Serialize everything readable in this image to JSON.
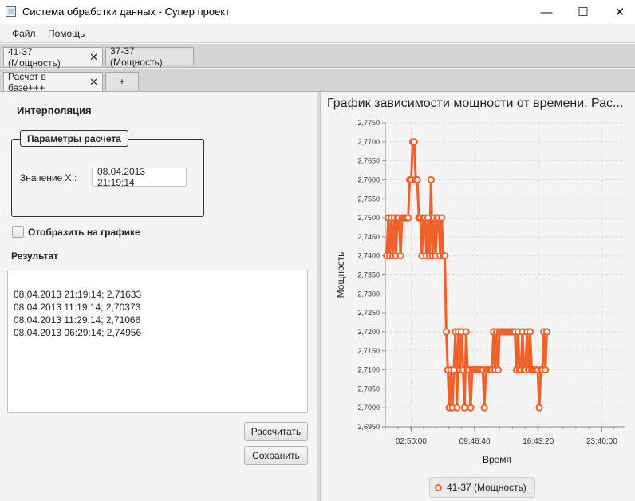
{
  "window": {
    "title": "Система обработки данных - Супер проект",
    "minimize": "—",
    "maximize": "☐",
    "close": "✕"
  },
  "menu": [
    "Файл",
    "Помощь"
  ],
  "tabs_row1": [
    {
      "label": "41-37 (Мощность)",
      "closable": true,
      "selected": true
    },
    {
      "label": "37-37 (Мощность)",
      "closable": false,
      "selected": false
    }
  ],
  "tabs_row2": [
    {
      "label": "Расчет в базе+++",
      "closable": true,
      "selected": true
    },
    {
      "label": "+",
      "closable": false,
      "selected": false
    }
  ],
  "form": {
    "heading": "Интерполяция",
    "group_title": "Параметры расчета",
    "x_label": "Значение X :",
    "x_value": "08.04.2013 21:19:14",
    "show_on_chart_label": "Отобразить на графике",
    "show_on_chart_checked": false,
    "result_label": "Результат",
    "result_lines": [
      "08.04.2013 21:19:14; 2,71633",
      "08.04.2013 11:19:14; 2,70373",
      "08.04.2013 11:29:14; 2,71066",
      "08.04.2013 06:29:14; 2,74956"
    ],
    "calc_button": "Рассчитать",
    "save_button": "Сохранить"
  },
  "accent": "#f0612a",
  "chart_data": {
    "type": "line",
    "title": "График зависимости мощности от времени. Рас...",
    "xlabel": "Время",
    "ylabel": "Мощность",
    "ylim": [
      2.695,
      2.775
    ],
    "yticks": [
      "2,6950",
      "2,7000",
      "2,7050",
      "2,7100",
      "2,7150",
      "2,7200",
      "2,7250",
      "2,7300",
      "2,7350",
      "2,7400",
      "2,7450",
      "2,7500",
      "2,7550",
      "2,7600",
      "2,7650",
      "2,7700",
      "2,7750"
    ],
    "xticks": [
      "02:50:00",
      "09:46:40",
      "16:43:20",
      "23:40:00"
    ],
    "x_unit_note": "minutes of day",
    "xlim": [
      0,
      1570
    ],
    "grid": true,
    "legend_position": "bottom",
    "series": [
      {
        "name": "41-37 (Мощность)",
        "color": "#f0612a",
        "points": [
          [
            10,
            2.74
          ],
          [
            20,
            2.75
          ],
          [
            30,
            2.74
          ],
          [
            40,
            2.75
          ],
          [
            50,
            2.74
          ],
          [
            60,
            2.75
          ],
          [
            70,
            2.74
          ],
          [
            80,
            2.75
          ],
          [
            90,
            2.75
          ],
          [
            100,
            2.74
          ],
          [
            110,
            2.75
          ],
          [
            120,
            2.75
          ],
          [
            130,
            2.75
          ],
          [
            140,
            2.75
          ],
          [
            150,
            2.75
          ],
          [
            160,
            2.76
          ],
          [
            170,
            2.76
          ],
          [
            180,
            2.77
          ],
          [
            190,
            2.77
          ],
          [
            200,
            2.76
          ],
          [
            210,
            2.76
          ],
          [
            220,
            2.75
          ],
          [
            230,
            2.75
          ],
          [
            240,
            2.74
          ],
          [
            250,
            2.75
          ],
          [
            260,
            2.75
          ],
          [
            270,
            2.74
          ],
          [
            280,
            2.75
          ],
          [
            290,
            2.74
          ],
          [
            300,
            2.76
          ],
          [
            310,
            2.74
          ],
          [
            320,
            2.75
          ],
          [
            330,
            2.74
          ],
          [
            340,
            2.75
          ],
          [
            350,
            2.75
          ],
          [
            360,
            2.74
          ],
          [
            370,
            2.75
          ],
          [
            380,
            2.74
          ],
          [
            390,
            2.74
          ],
          [
            400,
            2.72
          ],
          [
            410,
            2.71
          ],
          [
            420,
            2.7
          ],
          [
            430,
            2.71
          ],
          [
            440,
            2.7
          ],
          [
            450,
            2.71
          ],
          [
            460,
            2.72
          ],
          [
            470,
            2.7
          ],
          [
            480,
            2.72
          ],
          [
            490,
            2.71
          ],
          [
            500,
            2.72
          ],
          [
            510,
            2.71
          ],
          [
            520,
            2.7
          ],
          [
            530,
            2.72
          ],
          [
            540,
            2.71
          ],
          [
            550,
            2.71
          ],
          [
            560,
            2.7
          ],
          [
            570,
            2.71
          ],
          [
            580,
            2.71
          ],
          [
            590,
            2.71
          ],
          [
            600,
            2.71
          ],
          [
            610,
            2.71
          ],
          [
            620,
            2.71
          ],
          [
            630,
            2.71
          ],
          [
            640,
            2.71
          ],
          [
            650,
            2.7
          ],
          [
            660,
            2.71
          ],
          [
            670,
            2.71
          ],
          [
            680,
            2.71
          ],
          [
            690,
            2.71
          ],
          [
            700,
            2.71
          ],
          [
            710,
            2.72
          ],
          [
            720,
            2.71
          ],
          [
            730,
            2.72
          ],
          [
            740,
            2.71
          ],
          [
            750,
            2.72
          ],
          [
            760,
            2.72
          ],
          [
            770,
            2.72
          ],
          [
            780,
            2.72
          ],
          [
            790,
            2.72
          ],
          [
            800,
            2.72
          ],
          [
            810,
            2.72
          ],
          [
            820,
            2.72
          ],
          [
            830,
            2.72
          ],
          [
            840,
            2.72
          ],
          [
            850,
            2.72
          ],
          [
            860,
            2.71
          ],
          [
            870,
            2.72
          ],
          [
            880,
            2.71
          ],
          [
            890,
            2.71
          ],
          [
            900,
            2.72
          ],
          [
            910,
            2.71
          ],
          [
            920,
            2.71
          ],
          [
            930,
            2.72
          ],
          [
            940,
            2.71
          ],
          [
            950,
            2.72
          ],
          [
            960,
            2.71
          ],
          [
            970,
            2.71
          ],
          [
            980,
            2.71
          ],
          [
            990,
            2.71
          ],
          [
            1000,
            2.71
          ],
          [
            1010,
            2.7
          ],
          [
            1020,
            2.71
          ],
          [
            1030,
            2.71
          ],
          [
            1040,
            2.72
          ],
          [
            1050,
            2.71
          ],
          [
            1060,
            2.72
          ]
        ]
      }
    ]
  }
}
